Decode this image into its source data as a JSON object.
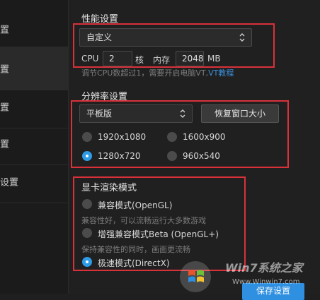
{
  "sidebar": {
    "items": [
      {
        "label": "置"
      },
      {
        "label": "置"
      },
      {
        "label": "置"
      },
      {
        "label": "置"
      },
      {
        "label": "设置"
      }
    ]
  },
  "performance": {
    "title": "性能设置",
    "mode_selected": "自定义",
    "cpu_label": "CPU",
    "cpu_value": "2",
    "cpu_unit": "核",
    "memory_label": "内存",
    "memory_value": "2048",
    "memory_unit": "MB",
    "hint": "调节CPU数超过1，需要开启电脑VT,",
    "hint_link": "VT教程"
  },
  "resolution": {
    "title": "分辨率设置",
    "device_selected": "平板版",
    "restore_button": "恢复窗口大小",
    "options": [
      {
        "label": "1920x1080",
        "checked": false
      },
      {
        "label": "1600x900",
        "checked": false
      },
      {
        "label": "1280x720",
        "checked": true
      },
      {
        "label": "960x540",
        "checked": false
      }
    ]
  },
  "render": {
    "title": "显卡渲染模式",
    "options": [
      {
        "label": "兼容模式(OpenGL)",
        "desc": "兼容性好，可以流畅运行大多数游戏",
        "checked": false
      },
      {
        "label": "增强兼容模式Beta (OpenGL+)",
        "desc": "保持兼容性的同时，画面更流畅",
        "checked": false
      },
      {
        "label": "极速模式(DirectX)",
        "desc": "",
        "checked": true
      }
    ]
  },
  "footer": {
    "save_button": "保存设置"
  },
  "watermark": {
    "brand": "Win7系统之家",
    "url": "Www.Winwin7.com"
  },
  "colors": {
    "highlight": "#d9313a",
    "accent": "#2e9be6"
  }
}
